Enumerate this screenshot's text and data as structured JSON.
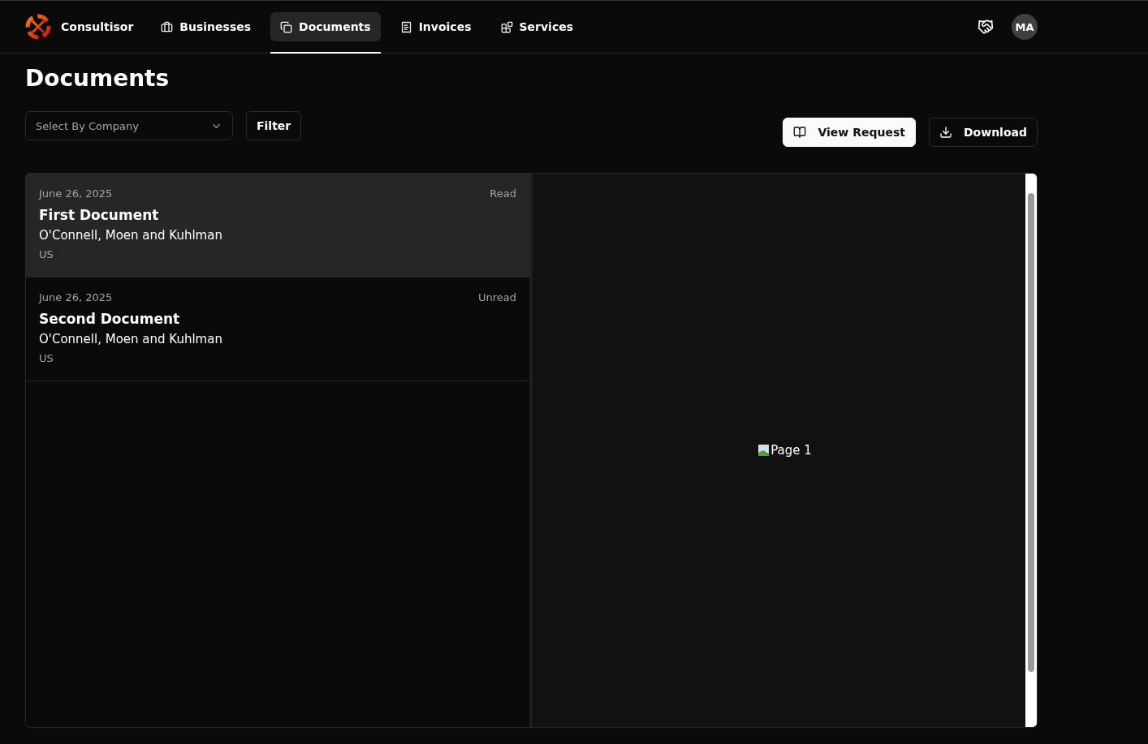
{
  "brand": {
    "name": "Consultisor"
  },
  "nav": [
    {
      "label": "Businesses",
      "selected": false
    },
    {
      "label": "Documents",
      "selected": true
    },
    {
      "label": "Invoices",
      "selected": false
    },
    {
      "label": "Services",
      "selected": false
    }
  ],
  "user": {
    "initials": "MA"
  },
  "page_title": "Documents",
  "company_select": {
    "placeholder": "Select By Company"
  },
  "filter_button": "Filter",
  "actions": [
    {
      "label": "View Request",
      "primary": true
    },
    {
      "label": "Download",
      "primary": false
    }
  ],
  "documents": [
    {
      "date": "June 26, 2025",
      "status": "Read",
      "title": "First Document",
      "company": "O'Connell, Moen and Kuhlman",
      "country": "US",
      "selected": true
    },
    {
      "date": "June 26, 2025",
      "status": "Unread",
      "title": "Second Document",
      "company": "O'Connell, Moen and Kuhlman",
      "country": "US",
      "selected": false
    }
  ],
  "preview": {
    "alt_text": "Page 1"
  }
}
